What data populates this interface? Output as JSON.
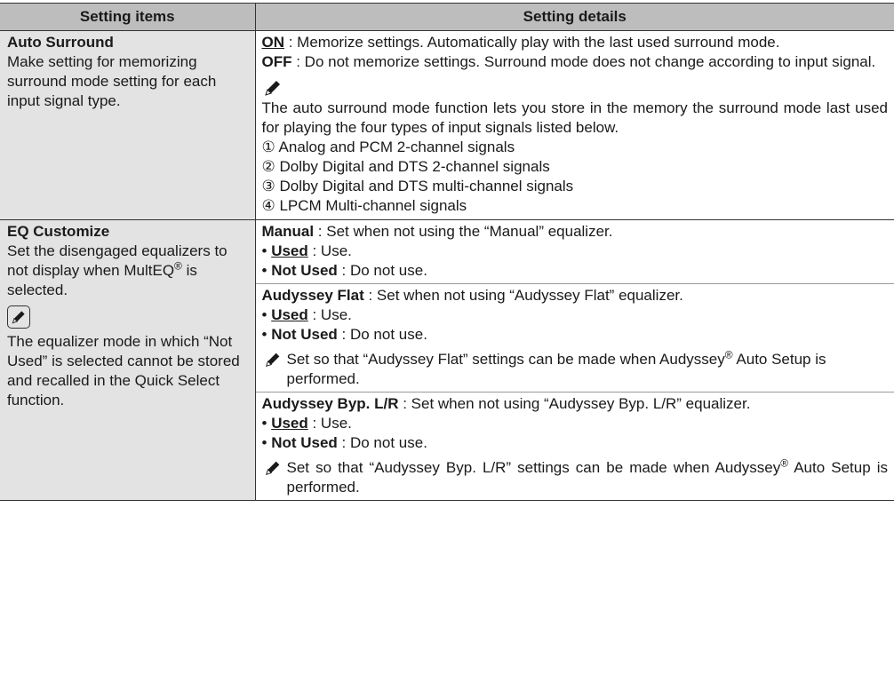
{
  "header": {
    "col1": "Setting items",
    "col2": "Setting details"
  },
  "auto_surround": {
    "title": "Auto Surround",
    "desc": "Make setting for memorizing surround mode setting for each input signal type.",
    "on_label": "ON",
    "on_text": " : Memorize settings. Automatically play with the last used surround mode.",
    "off_label": "OFF",
    "off_text": " : Do not memorize settings. Surround mode does not change according to input signal.",
    "note": "The auto surround mode function lets you store in the memory the surround mode last used for playing the four types of input signals listed below.",
    "signals": [
      "① Analog and PCM 2-channel signals",
      "② Dolby Digital and DTS 2-channel signals",
      "③ Dolby Digital and DTS multi-channel signals",
      "④ LPCM Multi-channel signals"
    ]
  },
  "eq_customize": {
    "title": "EQ Customize",
    "desc_pre": "Set the disengaged equalizers to not display when MultEQ",
    "desc_reg": "®",
    "desc_post": " is selected.",
    "note": "The equalizer mode in which “Not Used” is selected cannot be stored and recalled in the Quick Select function.",
    "bullet": "•",
    "used_label": "Used",
    "used_text": " : Use.",
    "not_used_label": "Not Used",
    "not_used_text": " : Do not use.",
    "manual_label": "Manual",
    "manual_text": " : Set when not using the “Manual” equalizer.",
    "flat_label": "Audyssey Flat",
    "flat_text": " : Set when not using “Audyssey Flat” equalizer.",
    "flat_note_pre": "Set so that “Audyssey Flat” settings can be made when Audyssey",
    "flat_note_reg": "®",
    "flat_note_post": " Auto Setup is performed.",
    "byp_label": "Audyssey Byp. L/R",
    "byp_text": " : Set when not using “Audyssey Byp. L/R” equalizer.",
    "byp_note_pre": "Set so that “Audyssey Byp. L/R” settings can be made when Audyssey",
    "byp_note_reg": "®",
    "byp_note_post": " Auto Setup is performed."
  }
}
